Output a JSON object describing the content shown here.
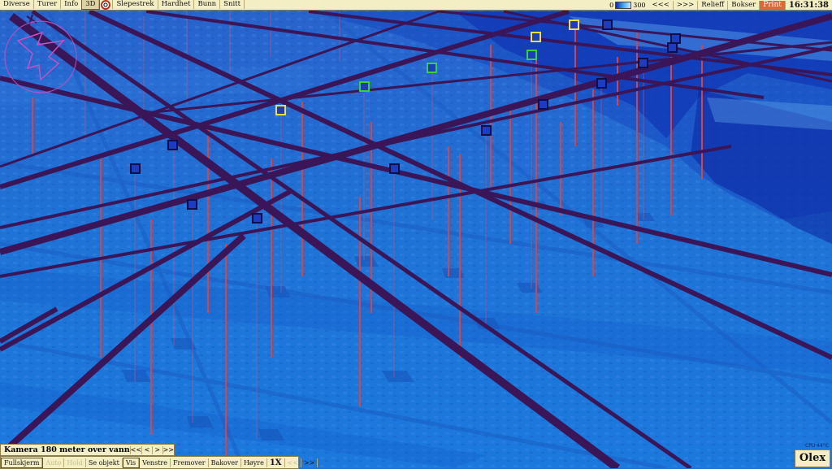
{
  "menu": {
    "items": [
      "Diverse",
      "Turer",
      "Info",
      "3D"
    ],
    "items2": [
      "Slepestrek",
      "Hardhet",
      "Bunn",
      "Snitt"
    ]
  },
  "depth_scale": {
    "min": "0",
    "max": "300"
  },
  "right_menu": {
    "back": "<<<",
    "forward": ">>>",
    "relief": "Relieff",
    "boxes": "Bokser",
    "print": "Print"
  },
  "clock": "16:31:38",
  "camera": {
    "text": "Kamera 180 meter over vann",
    "btn1": "<<",
    "btn2": "<",
    "btn3": ">",
    "btn4": ">>"
  },
  "bottom": {
    "fullscreen": "Fullskjerm",
    "auto": "Auto",
    "hold": "Hold",
    "see_object": "Se objekt",
    "show": "Vis",
    "left": "Venstre",
    "forward": "Fremover",
    "backward": "Bakover",
    "right": "Høyre",
    "speed": "1X",
    "slower": "<<",
    "faster": ">>"
  },
  "status": {
    "cpu": "CPU 44°C",
    "brand": "Olex"
  },
  "colors": {
    "sea": "#1e6fd0",
    "track": "#3a1658",
    "post": "#e04040",
    "panel": "#f4eec4",
    "print": "#e06636"
  },
  "icons": {
    "compass": "compass-arrow-icon",
    "pointer": "pointer-icon",
    "bullseye": "target-icon"
  }
}
